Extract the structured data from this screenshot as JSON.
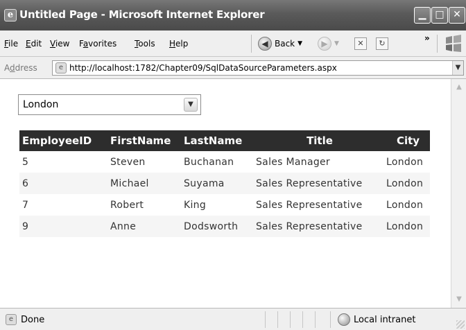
{
  "window": {
    "title": "Untitled Page - Microsoft Internet Explorer",
    "icon": "ie-page-icon",
    "minimize_glyph": "▁",
    "maximize_glyph": "□",
    "close_glyph": "✕"
  },
  "menu": {
    "items": [
      {
        "key": "F",
        "rest": "ile"
      },
      {
        "key": "E",
        "rest": "dit"
      },
      {
        "key": "V",
        "rest": "iew"
      },
      {
        "key": "a",
        "pre": "F",
        "rest": "vorites"
      },
      {
        "key": "T",
        "rest": "ools"
      },
      {
        "key": "H",
        "rest": "elp"
      }
    ],
    "back_label": "Back",
    "chevron": "»"
  },
  "address": {
    "label_pre": "A",
    "label_key": "d",
    "label_rest": "dress",
    "url": "http://localhost:1782/Chapter09/SqlDataSourceParameters.aspx"
  },
  "page": {
    "city_select": {
      "value": "London"
    },
    "table": {
      "headers": [
        "EmployeeID",
        "FirstName",
        "LastName",
        "Title",
        "City"
      ],
      "rows": [
        [
          "5",
          "Steven",
          "Buchanan",
          "Sales Manager",
          "London"
        ],
        [
          "6",
          "Michael",
          "Suyama",
          "Sales Representative",
          "London"
        ],
        [
          "7",
          "Robert",
          "King",
          "Sales Representative",
          "London"
        ],
        [
          "9",
          "Anne",
          "Dodsworth",
          "Sales Representative",
          "London"
        ]
      ]
    }
  },
  "status": {
    "text": "Done",
    "zone": "Local intranet"
  }
}
